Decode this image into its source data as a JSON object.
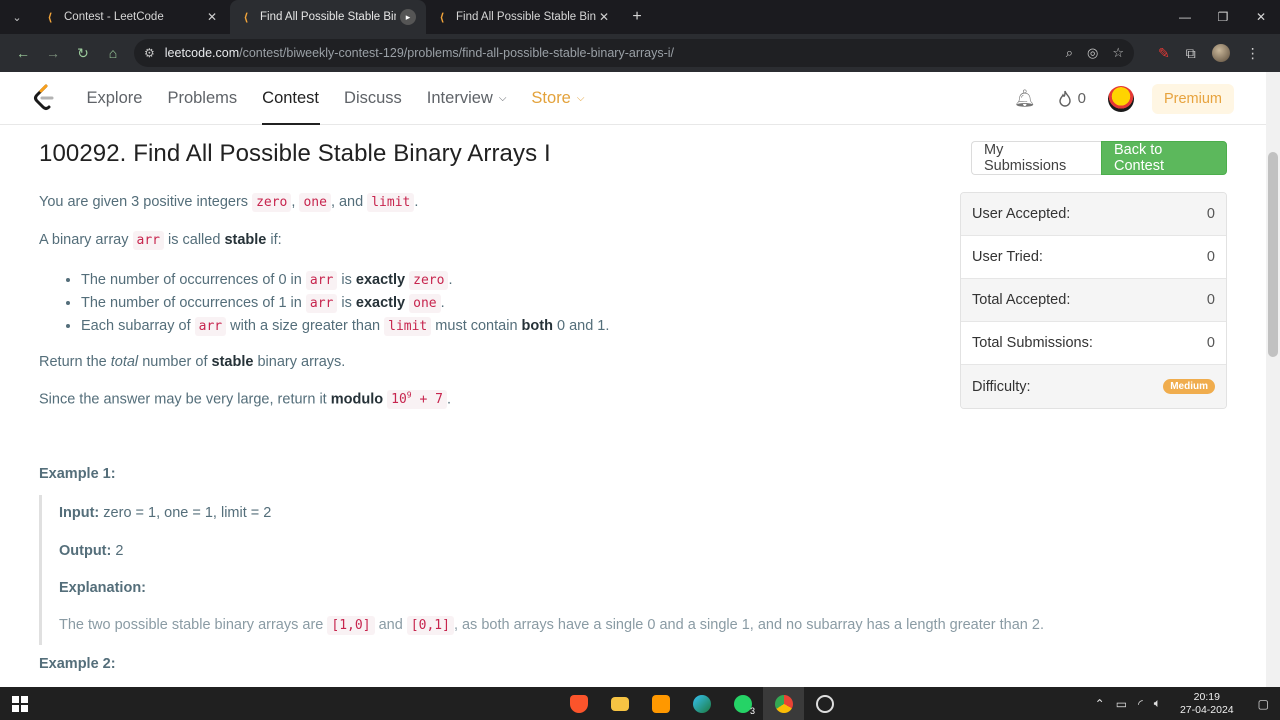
{
  "browser": {
    "tabs": [
      {
        "title": "Contest - LeetCode",
        "close": "✕"
      },
      {
        "title": "Find All Possible Stable Binary A",
        "close": "▸"
      },
      {
        "title": "Find All Possible Stable Binary A",
        "close": "✕"
      }
    ],
    "new_tab": "+",
    "url_host": "leetcode.com",
    "url_path": "/contest/biweekly-contest-129/problems/find-all-possible-stable-binary-arrays-i/"
  },
  "nav": {
    "items": [
      "Explore",
      "Problems",
      "Contest",
      "Discuss",
      "Interview",
      "Store"
    ],
    "streak_count": "0",
    "premium_label": "Premium"
  },
  "problem": {
    "title": "100292. Find All Possible Stable Binary Arrays I",
    "intro_pre": "You are given 3 positive integers",
    "intro_and": ", and",
    "code_zero": "zero",
    "code_one": "one",
    "code_limit": "limit",
    "code_arr": "arr",
    "stable_pre": "A binary array",
    "stable_mid": "is called",
    "stable_word": "stable",
    "stable_post": "if:",
    "rule1_pre": "The number of occurrences of 0 in",
    "rule2_pre": "The number of occurrences of 1 in",
    "rule_is": "is",
    "rule_exactly": "exactly",
    "rule3_pre": "Each subarray of",
    "rule3_mid": "with a size greater than",
    "rule3_post": "must contain",
    "rule3_both": "both",
    "rule3_end": "0 and 1.",
    "return_pre": "Return the",
    "return_total": "total",
    "return_mid": "number of",
    "return_stable": "stable",
    "return_post": "binary arrays.",
    "modulo_pre": "Since the answer may be very large, return it",
    "modulo_word": "modulo",
    "mod_base": "10",
    "mod_exp": "9",
    "mod_plus": " + 7"
  },
  "example1": {
    "title": "Example 1:",
    "input_label": "Input:",
    "input_value": "zero = 1, one = 1, limit = 2",
    "output_label": "Output:",
    "output_value": "2",
    "explanation_label": "Explanation:",
    "expl_pre": "The two possible stable binary arrays are",
    "arr1": "[1,0]",
    "expl_and": "and",
    "arr2": "[0,1]",
    "expl_post": ", as both arrays have a single 0 and a single 1, and no subarray has a length greater than 2."
  },
  "example2": {
    "title": "Example 2:"
  },
  "sidebar": {
    "my_submissions": "My Submissions",
    "back_to_contest": "Back to Contest",
    "stats": [
      {
        "label": "User Accepted:",
        "value": "0"
      },
      {
        "label": "User Tried:",
        "value": "0"
      },
      {
        "label": "Total Accepted:",
        "value": "0"
      },
      {
        "label": "Total Submissions:",
        "value": "0"
      }
    ],
    "difficulty_label": "Difficulty:",
    "difficulty_value": "Medium"
  },
  "taskbar": {
    "time": "20:19",
    "date": "27-04-2024",
    "whatsapp_badge": "3"
  },
  "colors": {
    "accent_green": "#5cb85c",
    "medium_badge": "#f0ad4e",
    "store_orange": "#e3a23b",
    "code_red": "#c7254e"
  }
}
